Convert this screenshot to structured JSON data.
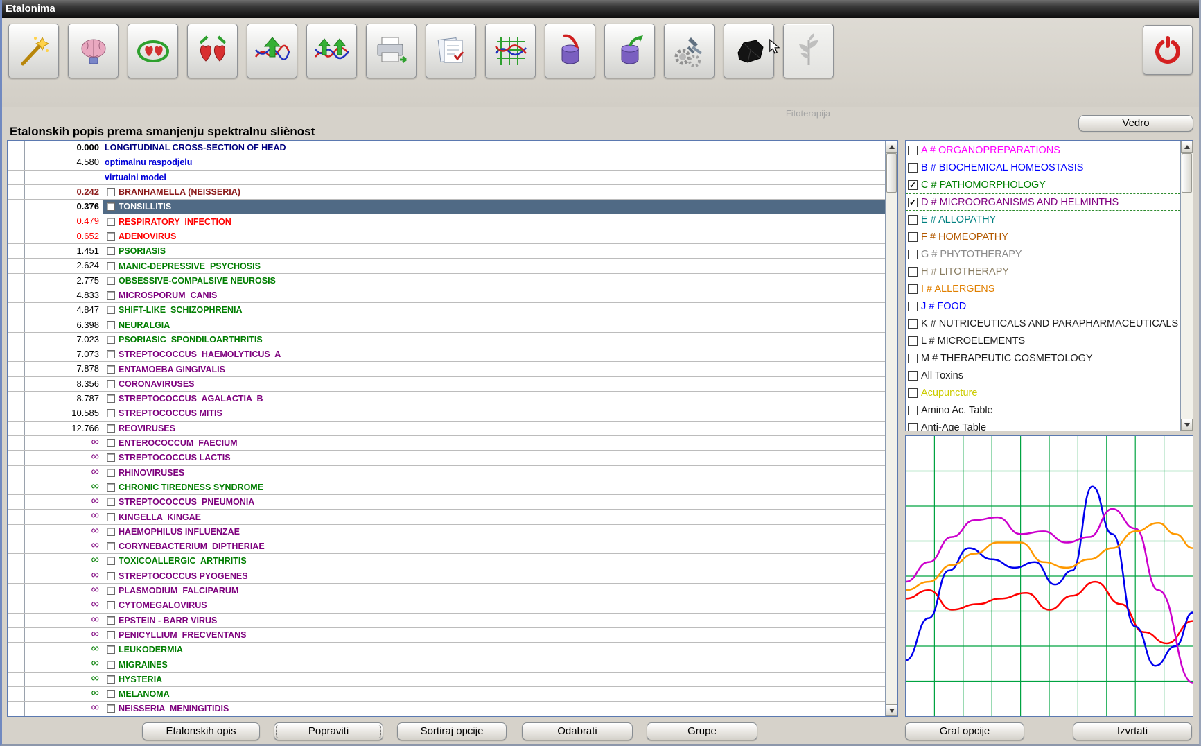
{
  "window": {
    "title": "Etalonima"
  },
  "toolbar": {
    "icons": [
      "magic-wand",
      "brain",
      "ring-hearts",
      "hearts-arrows",
      "chart-arrow-up",
      "chart-double-arrow",
      "printer",
      "notepad",
      "grid-chart",
      "container-in",
      "container-out",
      "gears-analysis",
      "etalon-stone",
      "phytotherapy"
    ],
    "phytotherapy_caption": "Fitoterapija",
    "exit_icon": "power"
  },
  "header": {
    "list_title": "Etalonskih popis prema smanjenju spektralnu sliènost",
    "vedro_button": "Vedro"
  },
  "list": {
    "rows": [
      {
        "value": "0.000",
        "value_color": "#000000",
        "value_bold": true,
        "label": "LONGITUDINAL CROSS-SECTION OF HEAD",
        "color": "#00007f",
        "checkbox": false,
        "selected": false
      },
      {
        "value": "4.580",
        "value_color": "#000000",
        "value_bold": false,
        "label": "optimalnu raspodjelu",
        "color": "#0000d8",
        "checkbox": false,
        "selected": false
      },
      {
        "value": "",
        "value_color": "#000000",
        "value_bold": false,
        "label": "virtualni model",
        "color": "#0000d8",
        "checkbox": false,
        "selected": false
      },
      {
        "value": "0.242",
        "value_color": "#8b1a1a",
        "value_bold": true,
        "label": "BRANHAMELLA (NEISSERIA)",
        "color": "#8b1a1a",
        "checkbox": true,
        "selected": false
      },
      {
        "value": "0.376",
        "value_color": "#000000",
        "value_bold": true,
        "label": "TONSILLITIS",
        "color": "#ffffff",
        "checkbox": true,
        "selected": true
      },
      {
        "value": "0.479",
        "value_color": "#ff0000",
        "value_bold": false,
        "label": "RESPIRATORY  INFECTION",
        "color": "#ff0000",
        "checkbox": true,
        "selected": false
      },
      {
        "value": "0.652",
        "value_color": "#ff0000",
        "value_bold": false,
        "label": "ADENOVIRUS",
        "color": "#ff0000",
        "checkbox": true,
        "selected": false
      },
      {
        "value": "1.451",
        "value_color": "#000000",
        "value_bold": false,
        "label": "PSORIASIS",
        "color": "#007d00",
        "checkbox": true,
        "selected": false
      },
      {
        "value": "2.624",
        "value_color": "#000000",
        "value_bold": false,
        "label": "MANIC-DEPRESSIVE  PSYCHOSIS",
        "color": "#007d00",
        "checkbox": true,
        "selected": false
      },
      {
        "value": "2.775",
        "value_color": "#000000",
        "value_bold": false,
        "label": "OBSESSIVE-COMPALSIVE NEUROSIS",
        "color": "#007d00",
        "checkbox": true,
        "selected": false
      },
      {
        "value": "4.833",
        "value_color": "#000000",
        "value_bold": false,
        "label": "MICROSPORUM  CANIS",
        "color": "#7d007d",
        "checkbox": true,
        "selected": false
      },
      {
        "value": "4.847",
        "value_color": "#000000",
        "value_bold": false,
        "label": "SHIFT-LIKE  SCHIZOPHRENIA",
        "color": "#007d00",
        "checkbox": true,
        "selected": false
      },
      {
        "value": "6.398",
        "value_color": "#000000",
        "value_bold": false,
        "label": "NEURALGIA",
        "color": "#007d00",
        "checkbox": true,
        "selected": false
      },
      {
        "value": "7.023",
        "value_color": "#000000",
        "value_bold": false,
        "label": "PSORIASIC  SPONDILOARTHRITIS",
        "color": "#007d00",
        "checkbox": true,
        "selected": false
      },
      {
        "value": "7.073",
        "value_color": "#000000",
        "value_bold": false,
        "label": "STREPTOCOCCUS  HAEMOLYTICUS  A",
        "color": "#7d007d",
        "checkbox": true,
        "selected": false
      },
      {
        "value": "7.878",
        "value_color": "#000000",
        "value_bold": false,
        "label": "ENTAMOEBA GINGIVALIS",
        "color": "#7d007d",
        "checkbox": true,
        "selected": false
      },
      {
        "value": "8.356",
        "value_color": "#000000",
        "value_bold": false,
        "label": "CORONAVIRUSES",
        "color": "#7d007d",
        "checkbox": true,
        "selected": false
      },
      {
        "value": "8.787",
        "value_color": "#000000",
        "value_bold": false,
        "label": "STREPTOCOCCUS  AGALACTIA  B",
        "color": "#7d007d",
        "checkbox": true,
        "selected": false
      },
      {
        "value": "10.585",
        "value_color": "#000000",
        "value_bold": false,
        "label": "STREPTOCOCCUS MITIS",
        "color": "#7d007d",
        "checkbox": true,
        "selected": false
      },
      {
        "value": "12.766",
        "value_color": "#000000",
        "value_bold": false,
        "label": "REOVIRUSES",
        "color": "#7d007d",
        "checkbox": true,
        "selected": false
      },
      {
        "value": "∞",
        "value_color": "#7d007d",
        "value_bold": false,
        "label": "ENTEROCOCCUM  FAECIUM",
        "color": "#7d007d",
        "checkbox": true,
        "selected": false
      },
      {
        "value": "∞",
        "value_color": "#7d007d",
        "value_bold": false,
        "label": "STREPTOCOCCUS LACTIS",
        "color": "#7d007d",
        "checkbox": true,
        "selected": false
      },
      {
        "value": "∞",
        "value_color": "#7d007d",
        "value_bold": false,
        "label": "RHINOVIRUSES",
        "color": "#7d007d",
        "checkbox": true,
        "selected": false
      },
      {
        "value": "∞",
        "value_color": "#007d00",
        "value_bold": false,
        "label": "CHRONIC TIREDNESS SYNDROME",
        "color": "#007d00",
        "checkbox": true,
        "selected": false
      },
      {
        "value": "∞",
        "value_color": "#7d007d",
        "value_bold": false,
        "label": "STREPTOCOCCUS  PNEUMONIA",
        "color": "#7d007d",
        "checkbox": true,
        "selected": false
      },
      {
        "value": "∞",
        "value_color": "#7d007d",
        "value_bold": false,
        "label": "KINGELLA  KINGAE",
        "color": "#7d007d",
        "checkbox": true,
        "selected": false
      },
      {
        "value": "∞",
        "value_color": "#7d007d",
        "value_bold": false,
        "label": "HAEMOPHILUS INFLUENZAE",
        "color": "#7d007d",
        "checkbox": true,
        "selected": false
      },
      {
        "value": "∞",
        "value_color": "#7d007d",
        "value_bold": false,
        "label": "CORYNEBACTERIUM  DIPTHERIAE",
        "color": "#7d007d",
        "checkbox": true,
        "selected": false
      },
      {
        "value": "∞",
        "value_color": "#007d00",
        "value_bold": false,
        "label": "TOXICOALLERGIC  ARTHRITIS",
        "color": "#007d00",
        "checkbox": true,
        "selected": false
      },
      {
        "value": "∞",
        "value_color": "#7d007d",
        "value_bold": false,
        "label": "STREPTOCOCCUS PYOGENES",
        "color": "#7d007d",
        "checkbox": true,
        "selected": false
      },
      {
        "value": "∞",
        "value_color": "#7d007d",
        "value_bold": false,
        "label": "PLASMODIUM  FALCIPARUM",
        "color": "#7d007d",
        "checkbox": true,
        "selected": false
      },
      {
        "value": "∞",
        "value_color": "#7d007d",
        "value_bold": false,
        "label": "CYTOMEGALOVIRUS",
        "color": "#7d007d",
        "checkbox": true,
        "selected": false
      },
      {
        "value": "∞",
        "value_color": "#7d007d",
        "value_bold": false,
        "label": "EPSTEIN - BARR VIRUS",
        "color": "#7d007d",
        "checkbox": true,
        "selected": false
      },
      {
        "value": "∞",
        "value_color": "#7d007d",
        "value_bold": false,
        "label": "PENICYLLIUM  FRECVENTANS",
        "color": "#7d007d",
        "checkbox": true,
        "selected": false
      },
      {
        "value": "∞",
        "value_color": "#007d00",
        "value_bold": false,
        "label": "LEUKODERMIA",
        "color": "#007d00",
        "checkbox": true,
        "selected": false
      },
      {
        "value": "∞",
        "value_color": "#007d00",
        "value_bold": false,
        "label": "MIGRAINES",
        "color": "#007d00",
        "checkbox": true,
        "selected": false
      },
      {
        "value": "∞",
        "value_color": "#007d00",
        "value_bold": false,
        "label": "HYSTERIA",
        "color": "#007d00",
        "checkbox": true,
        "selected": false
      },
      {
        "value": "∞",
        "value_color": "#007d00",
        "value_bold": false,
        "label": "MELANOMA",
        "color": "#007d00",
        "checkbox": true,
        "selected": false
      },
      {
        "value": "∞",
        "value_color": "#7d007d",
        "value_bold": false,
        "label": "NEISSERIA  MENINGITIDIS",
        "color": "#7d007d",
        "checkbox": true,
        "selected": false
      }
    ]
  },
  "categories": {
    "items": [
      {
        "label": "A # ORGANOPREPARATIONS",
        "color": "#ff00ff",
        "checked": false,
        "focused": false
      },
      {
        "label": "B # BIOCHEMICAL HOMEOSTASIS",
        "color": "#0000ff",
        "checked": false,
        "focused": false
      },
      {
        "label": "C # PATHOMORPHOLOGY",
        "color": "#008000",
        "checked": true,
        "focused": false
      },
      {
        "label": "D # MICROORGANISMS AND HELMINTHS",
        "color": "#800080",
        "checked": true,
        "focused": true
      },
      {
        "label": "E # ALLOPATHY",
        "color": "#008080",
        "checked": false,
        "focused": false
      },
      {
        "label": "F # HOMEOPATHY",
        "color": "#b35900",
        "checked": false,
        "focused": false
      },
      {
        "label": "G # PHYTOTHERAPY",
        "color": "#8a8a8a",
        "checked": false,
        "focused": false
      },
      {
        "label": "H # LITOTHERAPY",
        "color": "#8a7d62",
        "checked": false,
        "focused": false
      },
      {
        "label": "I # ALLERGENS",
        "color": "#e07f00",
        "checked": false,
        "focused": false
      },
      {
        "label": "J # FOOD",
        "color": "#0000ff",
        "checked": false,
        "focused": false
      },
      {
        "label": "K # NUTRICEUTICALS AND PARAPHARMACEUTICALS",
        "color": "#1a1a1a",
        "checked": false,
        "focused": false
      },
      {
        "label": "L # MICROELEMENTS",
        "color": "#1a1a1a",
        "checked": false,
        "focused": false
      },
      {
        "label": "M # THERAPEUTIC COSMETOLOGY",
        "color": "#1a1a1a",
        "checked": false,
        "focused": false
      },
      {
        "label": "All Toxins",
        "color": "#1a1a1a",
        "checked": false,
        "focused": false
      },
      {
        "label": "Acupuncture",
        "color": "#cccc00",
        "checked": false,
        "focused": false
      },
      {
        "label": "Amino Ac. Table",
        "color": "#1a1a1a",
        "checked": false,
        "focused": false
      },
      {
        "label": "Anti-Age Table",
        "color": "#1a1a1a",
        "checked": false,
        "focused": false
      }
    ]
  },
  "graph": {
    "grid": {
      "v": 10,
      "h": 8
    },
    "grid_color": "#00a341",
    "series": [
      {
        "name": "red",
        "color": "#ff0000",
        "points": [
          [
            0,
            58
          ],
          [
            8,
            55
          ],
          [
            16,
            62
          ],
          [
            25,
            60
          ],
          [
            33,
            58
          ],
          [
            42,
            56
          ],
          [
            50,
            62
          ],
          [
            58,
            57
          ],
          [
            66,
            52
          ],
          [
            75,
            60
          ],
          [
            83,
            70
          ],
          [
            91,
            74
          ],
          [
            100,
            66
          ]
        ]
      },
      {
        "name": "blue",
        "color": "#0000ee",
        "points": [
          [
            0,
            80
          ],
          [
            8,
            65
          ],
          [
            15,
            48
          ],
          [
            22,
            40
          ],
          [
            30,
            44
          ],
          [
            38,
            47
          ],
          [
            45,
            45
          ],
          [
            52,
            53
          ],
          [
            58,
            48
          ],
          [
            65,
            18
          ],
          [
            72,
            35
          ],
          [
            80,
            68
          ],
          [
            87,
            82
          ],
          [
            94,
            75
          ],
          [
            100,
            63
          ]
        ]
      },
      {
        "name": "magenta",
        "color": "#cc00cc",
        "points": [
          [
            0,
            52
          ],
          [
            8,
            45
          ],
          [
            16,
            36
          ],
          [
            24,
            30
          ],
          [
            32,
            29
          ],
          [
            40,
            35
          ],
          [
            48,
            34
          ],
          [
            56,
            38
          ],
          [
            64,
            36
          ],
          [
            72,
            26
          ],
          [
            80,
            33
          ],
          [
            88,
            55
          ],
          [
            100,
            88
          ]
        ]
      },
      {
        "name": "orange",
        "color": "#ff9900",
        "points": [
          [
            0,
            55
          ],
          [
            8,
            52
          ],
          [
            16,
            46
          ],
          [
            24,
            42
          ],
          [
            32,
            38
          ],
          [
            40,
            38
          ],
          [
            48,
            45
          ],
          [
            56,
            47
          ],
          [
            64,
            44
          ],
          [
            72,
            40
          ],
          [
            80,
            34
          ],
          [
            88,
            31
          ],
          [
            94,
            35
          ],
          [
            100,
            40
          ]
        ]
      }
    ]
  },
  "footer": {
    "left": [
      "Etalonskih opis",
      "Popraviti",
      "Sortiraj opcije",
      "Odabrati",
      "Grupe"
    ],
    "right": [
      "Graf opcije",
      "Izvrtati"
    ]
  }
}
